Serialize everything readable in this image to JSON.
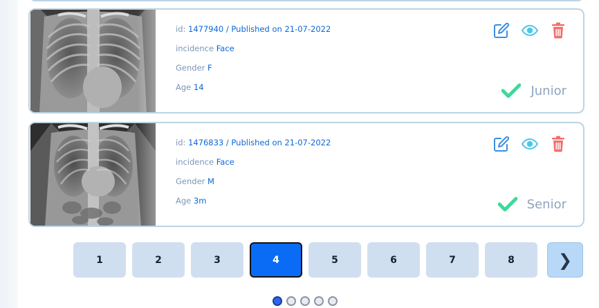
{
  "cards": [
    {
      "id_label": "id:",
      "id": "1477940",
      "published_label": "/ Published on",
      "published_date": "21-07-2022",
      "incidence_label": "incidence",
      "incidence": "Face",
      "gender_label": "Gender",
      "gender": "F",
      "age_label": "Age",
      "age": "14",
      "level": "Junior",
      "xray_image": "chest-xray-image"
    },
    {
      "id_label": "id:",
      "id": "1476833",
      "published_label": "/ Published on",
      "published_date": "21-07-2022",
      "incidence_label": "incidence",
      "incidence": "Face",
      "gender_label": "Gender",
      "gender": "M",
      "age_label": "Age",
      "age": "3m",
      "level": "Senior",
      "xray_image": "chest-xray-image"
    }
  ],
  "pagination": {
    "pages": [
      "1",
      "2",
      "3",
      "4",
      "5",
      "6",
      "7",
      "8"
    ],
    "current": "4",
    "next_icon": "chevron-right-icon"
  },
  "icons": {
    "edit": "edit-icon",
    "view": "eye-icon",
    "delete": "trash-icon",
    "level": "check-icon"
  },
  "colors": {
    "accent_blue": "#0a66d9",
    "edit": "#3a8fe0",
    "view": "#4bc7e8",
    "delete": "#f26f6a",
    "check": "#3ed99a",
    "page_active": "#0a6cf5",
    "page_inactive": "#d0dff0"
  },
  "carousel": {
    "dot_count": 5,
    "active_index": 0
  }
}
